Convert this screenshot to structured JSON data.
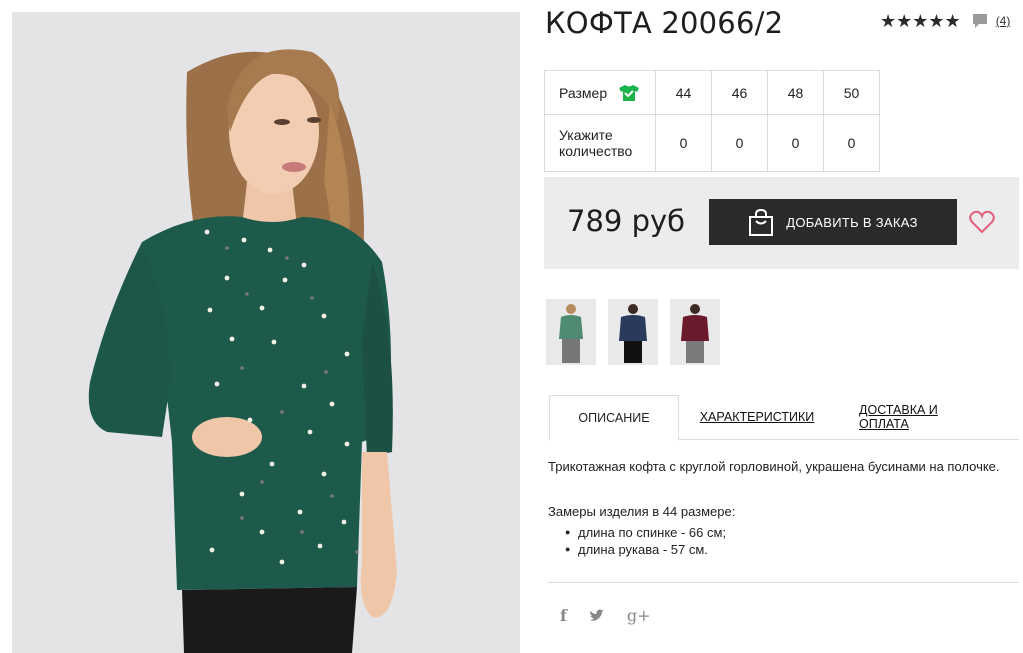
{
  "product": {
    "title": "КОФТА 20066/2",
    "rating": {
      "stars": "★★★★★",
      "reviews": "(4)"
    },
    "sizes": {
      "size_label": "Размер",
      "qty_label_1": "Укажите",
      "qty_label_2": "количество",
      "values": [
        "44",
        "46",
        "48",
        "50"
      ],
      "quantities": [
        "0",
        "0",
        "0",
        "0"
      ]
    },
    "price": "789 руб",
    "add_button": "ДОБАВИТЬ В ЗАКАЗ",
    "thumbnail_colors": [
      "#4f8a72",
      "#2a3a5c",
      "#6b1a2c"
    ]
  },
  "tabs": [
    "ОПИСАНИЕ",
    "ХАРАКТЕРИСТИКИ",
    "ДОСТАВКА И ОПЛАТА"
  ],
  "description": {
    "text": "Трикотажная кофта с круглой горловиной, украшена бусинами на полочке.",
    "measurements_title": "Замеры изделия в 44 размере:",
    "items": [
      "длина по спинке - 66 см;",
      "длина рукава - 57 см."
    ]
  },
  "social": [
    "f",
    "g+"
  ],
  "colors": {
    "accent_green": "#1bb34a",
    "heart": "#e0607a",
    "button_bg": "#2a2a2a"
  }
}
